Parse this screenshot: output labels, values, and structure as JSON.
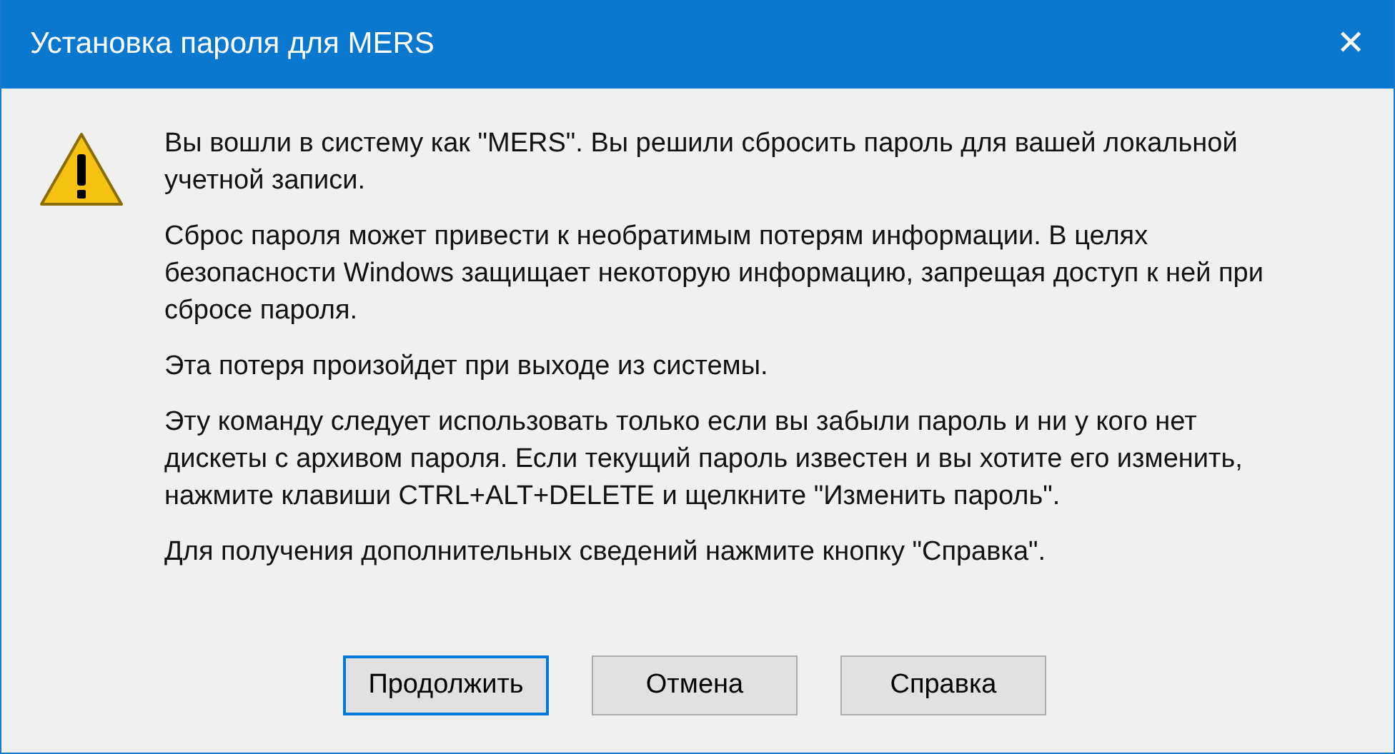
{
  "window": {
    "title": "Установка пароля для MERS",
    "close": "✕"
  },
  "message": {
    "paragraphs": [
      "Вы вошли в систему как \"MERS\". Вы решили сбросить пароль для вашей локальной учетной записи.",
      "Сброс пароля может привести к необратимым потерям информации. В целях безопасности Windows защищает некоторую информацию, запрещая доступ к ней при сбросе пароля.",
      "Эта потеря произойдет при выходе из системы.",
      "Эту команду следует использовать только если вы забыли пароль и ни у кого нет дискеты с архивом пароля. Если текущий пароль известен и вы хотите его изменить, нажмите клавиши CTRL+ALT+DELETE и щелкните \"Изменить пароль\".",
      "Для получения дополнительных сведений нажмите кнопку \"Справка\"."
    ]
  },
  "buttons": [
    {
      "label": "Продолжить",
      "selected": true
    },
    {
      "label": "Отмена",
      "selected": false
    },
    {
      "label": "Справка",
      "selected": false
    }
  ]
}
